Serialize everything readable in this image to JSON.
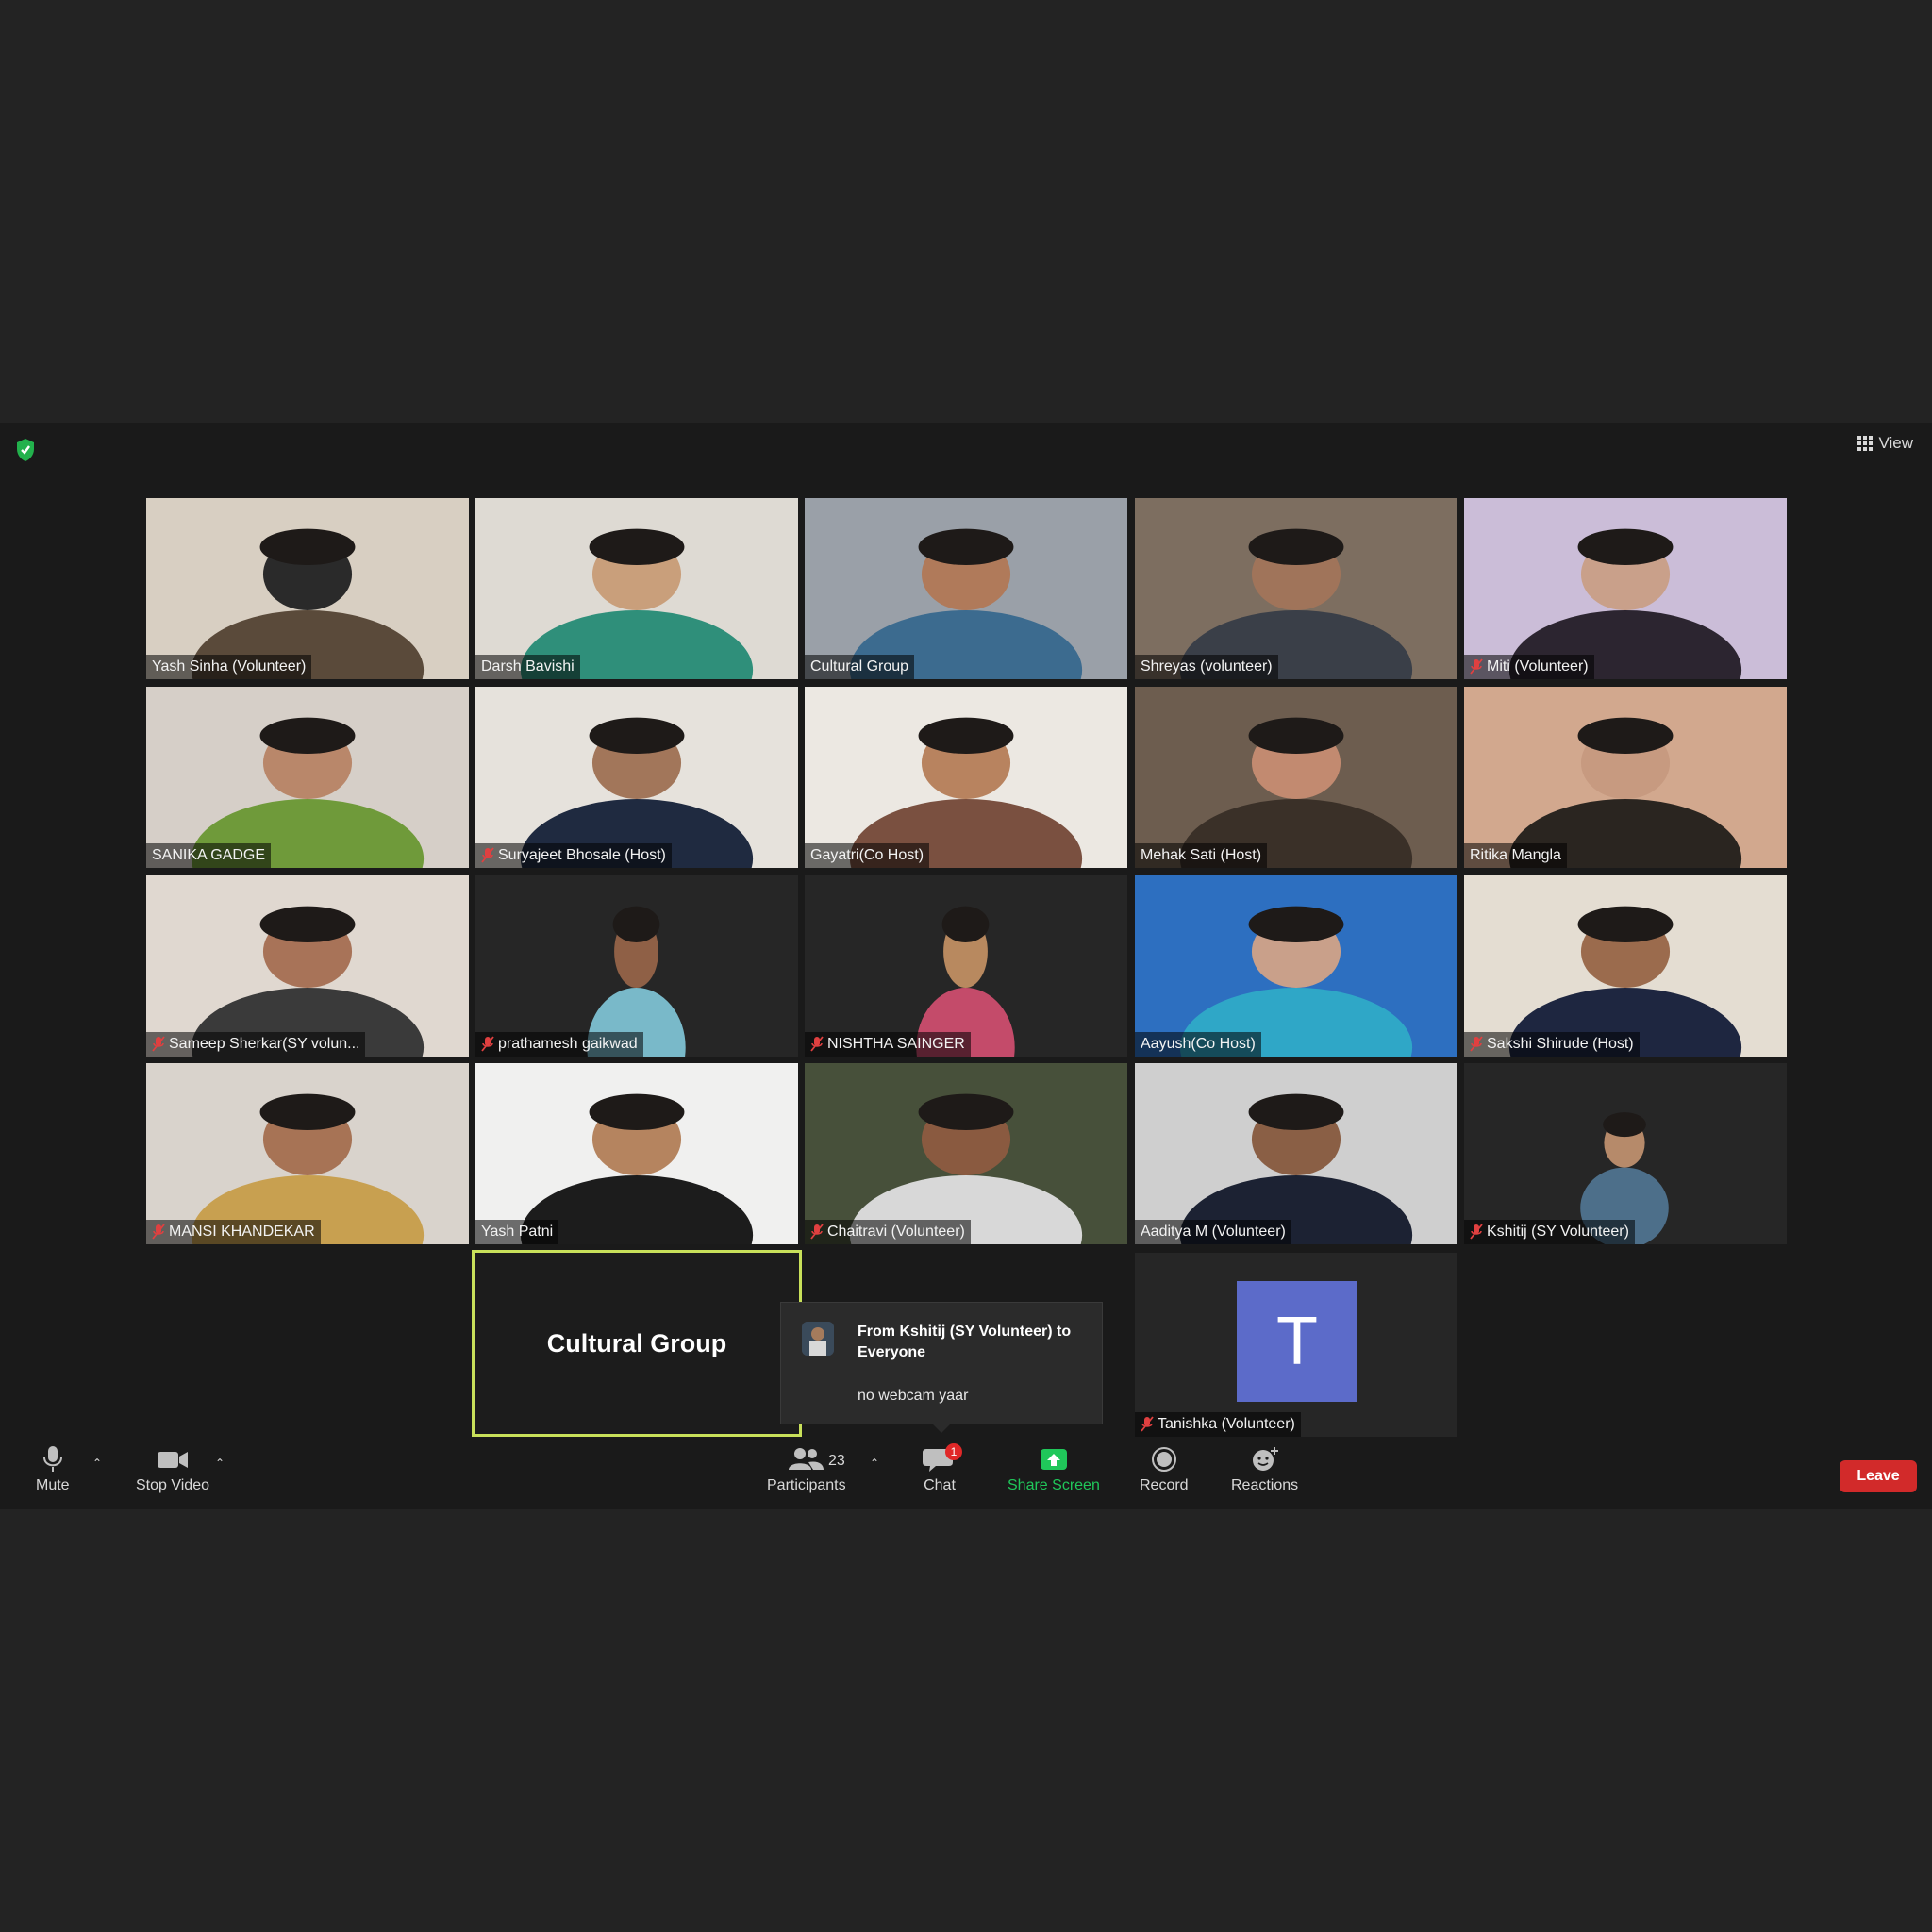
{
  "header": {
    "view_label": "View"
  },
  "participants": [
    {
      "name": "Yash Sinha (Volunteer)",
      "muted": false
    },
    {
      "name": "Darsh Bavishi",
      "muted": false
    },
    {
      "name": "Cultural Group",
      "muted": false
    },
    {
      "name": "Shreyas (volunteer)",
      "muted": false
    },
    {
      "name": "Miti (Volunteer)",
      "muted": true
    },
    {
      "name": "SANIKA GADGE",
      "muted": false
    },
    {
      "name": "Suryajeet Bhosale (Host)",
      "muted": true
    },
    {
      "name": "Gayatri(Co Host)",
      "muted": false
    },
    {
      "name": "Mehak Sati (Host)",
      "muted": false
    },
    {
      "name": "Ritika Mangla",
      "muted": false
    },
    {
      "name": "Sameep Sherkar(SY volun...",
      "muted": true
    },
    {
      "name": "prathamesh gaikwad",
      "muted": true
    },
    {
      "name": "NISHTHA SAINGER",
      "muted": true
    },
    {
      "name": "Aayush(Co Host)",
      "muted": false
    },
    {
      "name": "Sakshi Shirude (Host)",
      "muted": true
    },
    {
      "name": "MANSI KHANDEKAR",
      "muted": true
    },
    {
      "name": "Yash Patni",
      "muted": false
    },
    {
      "name": "Chaitravi (Volunteer)",
      "muted": true
    },
    {
      "name": "Aaditya M (Volunteer)",
      "muted": false
    },
    {
      "name": "Kshitij (SY Volunteer)",
      "muted": true
    }
  ],
  "active_speaker": {
    "name": "Cultural Group"
  },
  "no_video_tile": {
    "initial": "T",
    "name": "Tanishka (Volunteer)",
    "muted": true
  },
  "chat_popup": {
    "from": "From Kshitij (SY Volunteer) to Everyone",
    "message": "no webcam yaar"
  },
  "toolbar": {
    "mute_label": "Mute",
    "stop_video_label": "Stop Video",
    "participants_label": "Participants",
    "participant_count": "23",
    "chat_label": "Chat",
    "chat_badge": "1",
    "share_screen_label": "Share Screen",
    "record_label": "Record",
    "reactions_label": "Reactions",
    "leave_label": "Leave"
  },
  "colors": {
    "accent_green": "#20c75a",
    "leave_red": "#d22a2a",
    "active_border": "#c8e05a",
    "avatar_blue": "#5c6bc9"
  }
}
